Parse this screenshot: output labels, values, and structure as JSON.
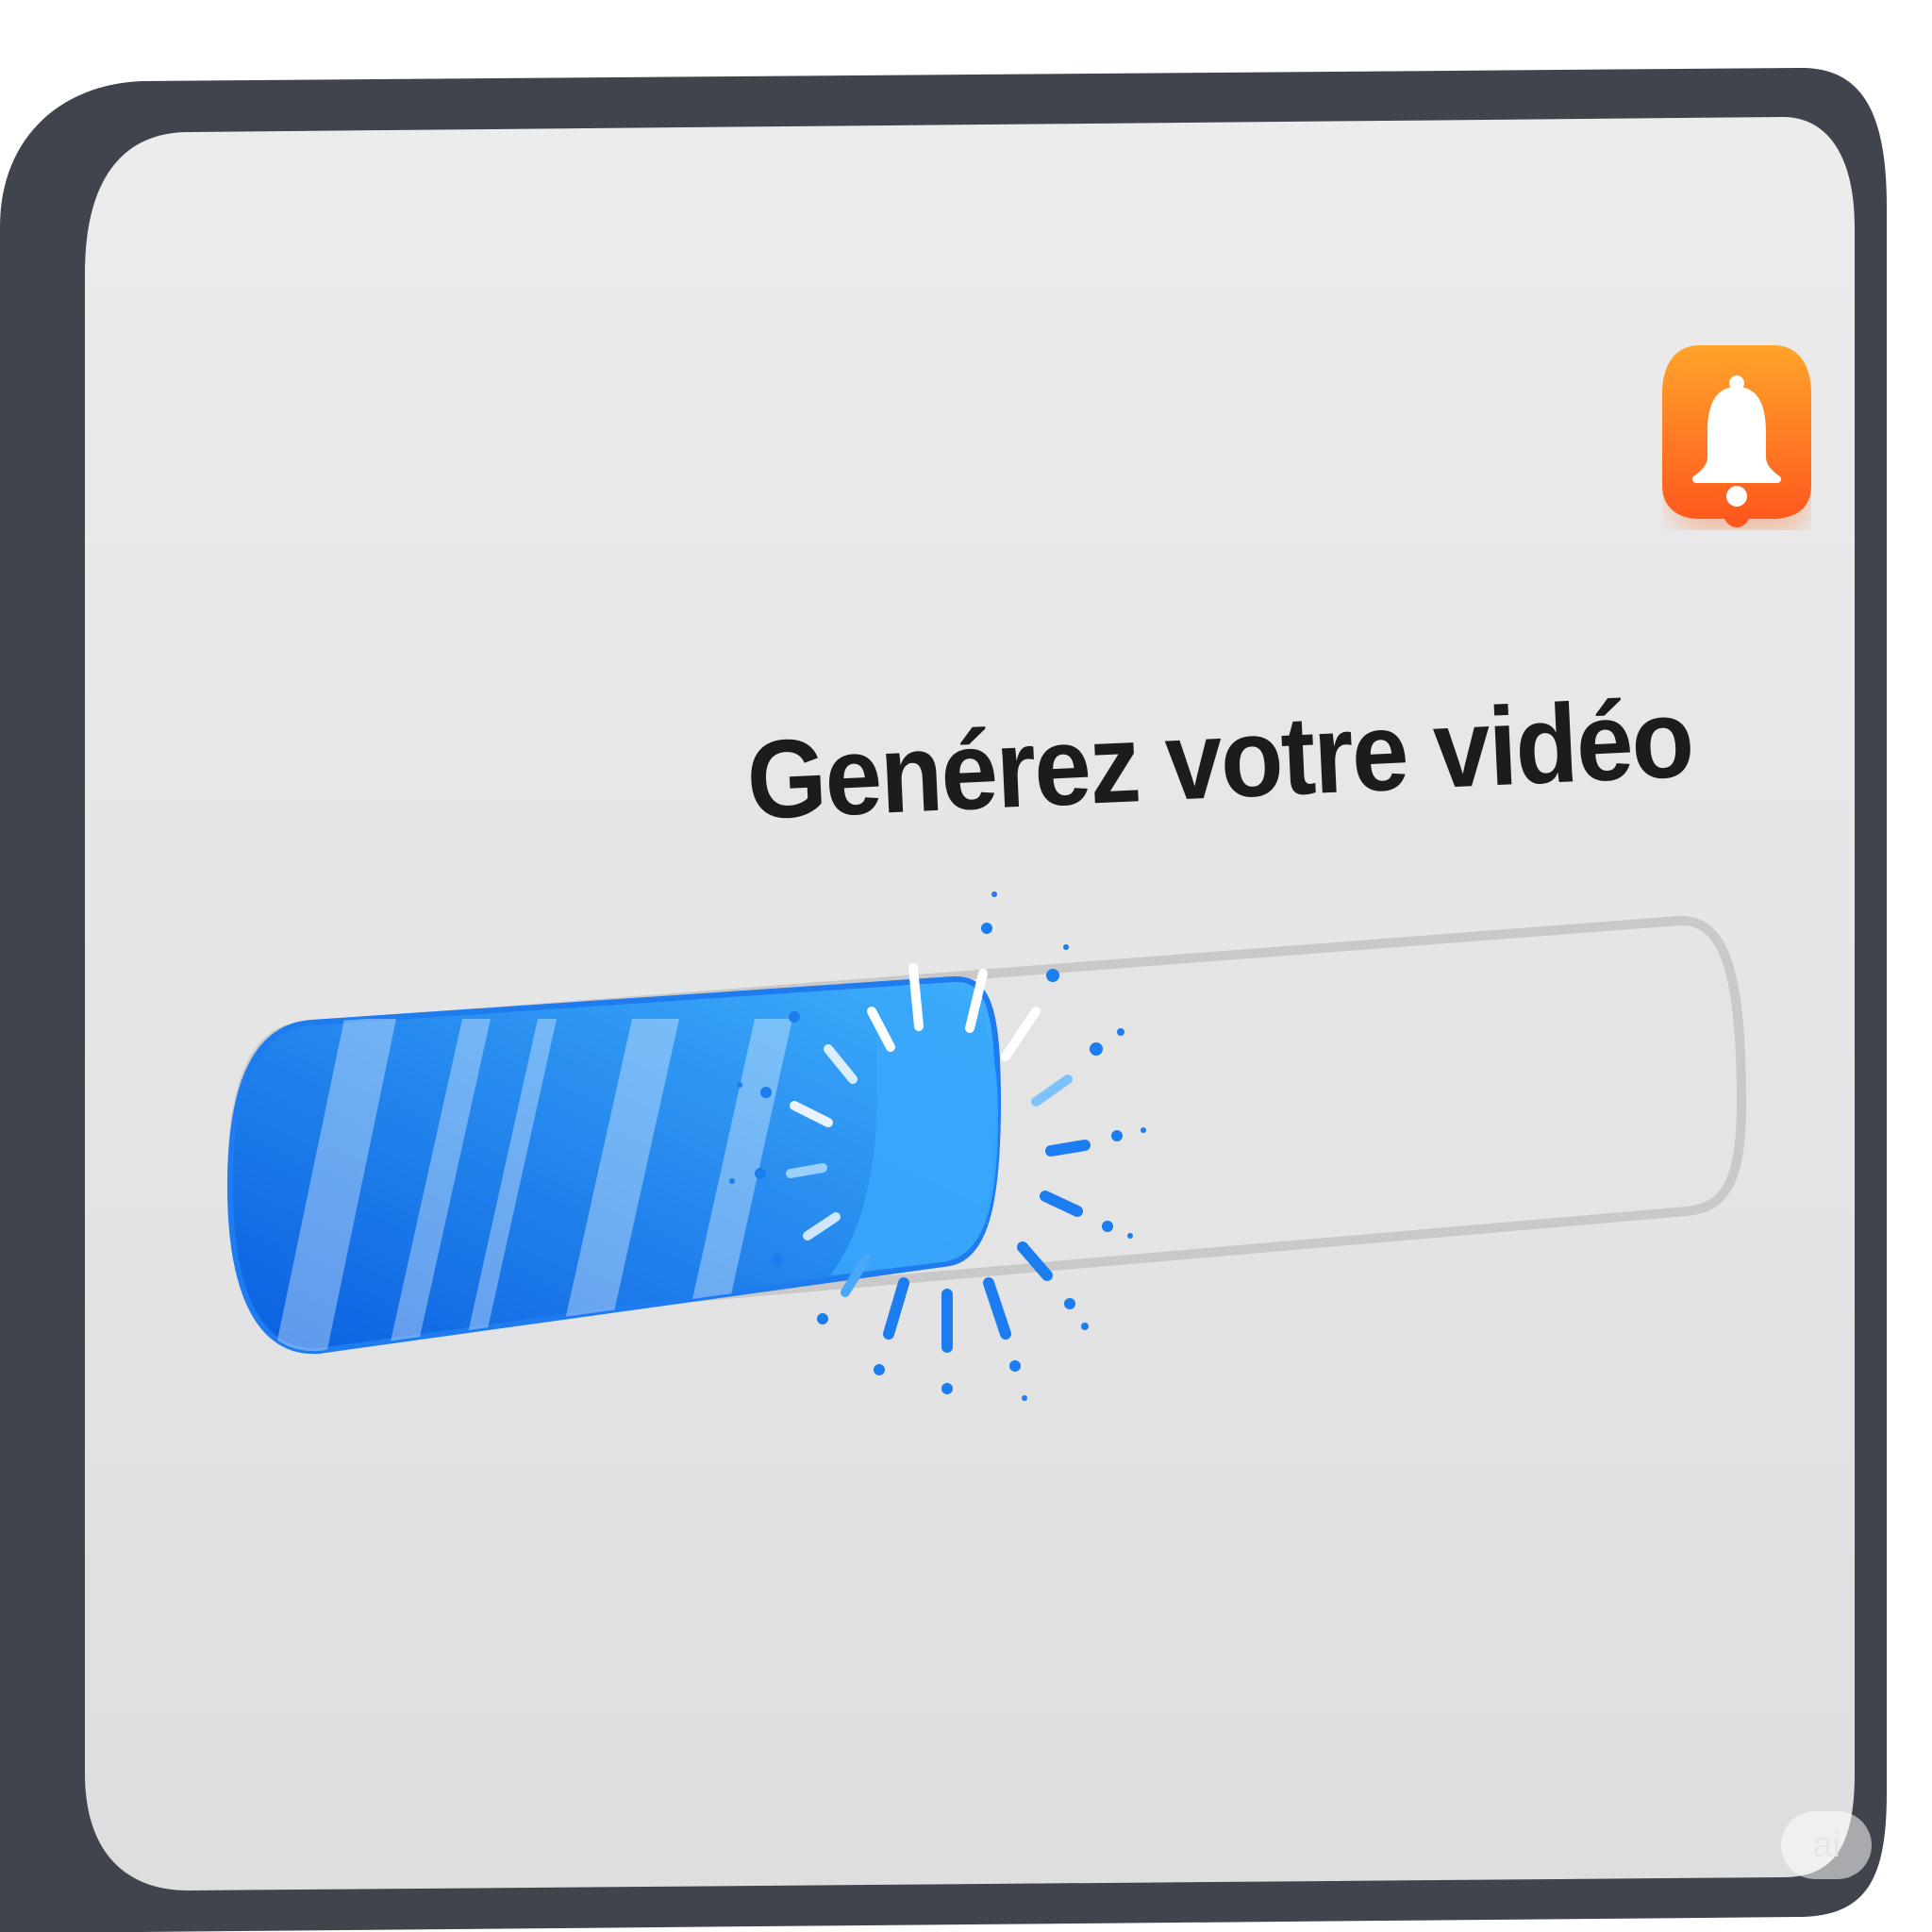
{
  "headline": "Generez votre video",
  "headline_text": "Genérez votre vidéo",
  "progress": {
    "value_percent": 51,
    "fill_color_start": "#0a5fe0",
    "fill_color_end": "#39a8fb",
    "track_color": "#e2e2e3"
  },
  "notification_button": {
    "icon": "bell-icon",
    "color_start": "#ff9f1c",
    "color_end": "#ff5a1f"
  },
  "device": {
    "frame_color": "#3f444d",
    "screen_color": "#e8e8e9"
  },
  "watermark": "ai"
}
